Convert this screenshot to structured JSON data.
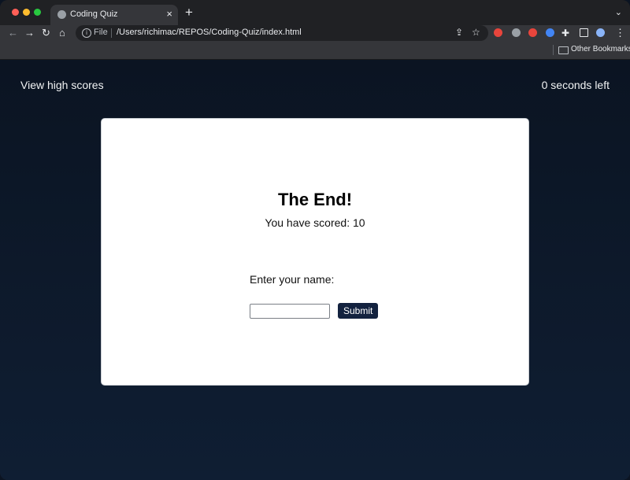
{
  "browser": {
    "tab_title": "Coding Quiz",
    "tab_close": "×",
    "new_tab": "+",
    "tab_menu": "⌄",
    "back": "←",
    "forward": "→",
    "reload": "↻",
    "home": "⌂",
    "info": "i",
    "file_label": "File",
    "url": "/Users/richimac/REPOS/Coding-Quiz/index.html",
    "bookmarks_label": "Other Bookmarks",
    "extension_colors": [
      "#e8453c",
      "#9aa0a6",
      "#e8453c",
      "#4285f4",
      "#e8eaed",
      "#e8eaed",
      "#8ab4f8"
    ]
  },
  "header": {
    "high_scores_link": "View high scores",
    "timer_text": "0 seconds left"
  },
  "result": {
    "title": "The End!",
    "score_text": "You have scored: 10",
    "name_prompt": "Enter your name:",
    "name_value": "",
    "submit_label": "Submit"
  },
  "colors": {
    "page_bg_top": "#0b1422",
    "page_bg_bottom": "#0f1e33",
    "button_bg": "#13223f"
  }
}
